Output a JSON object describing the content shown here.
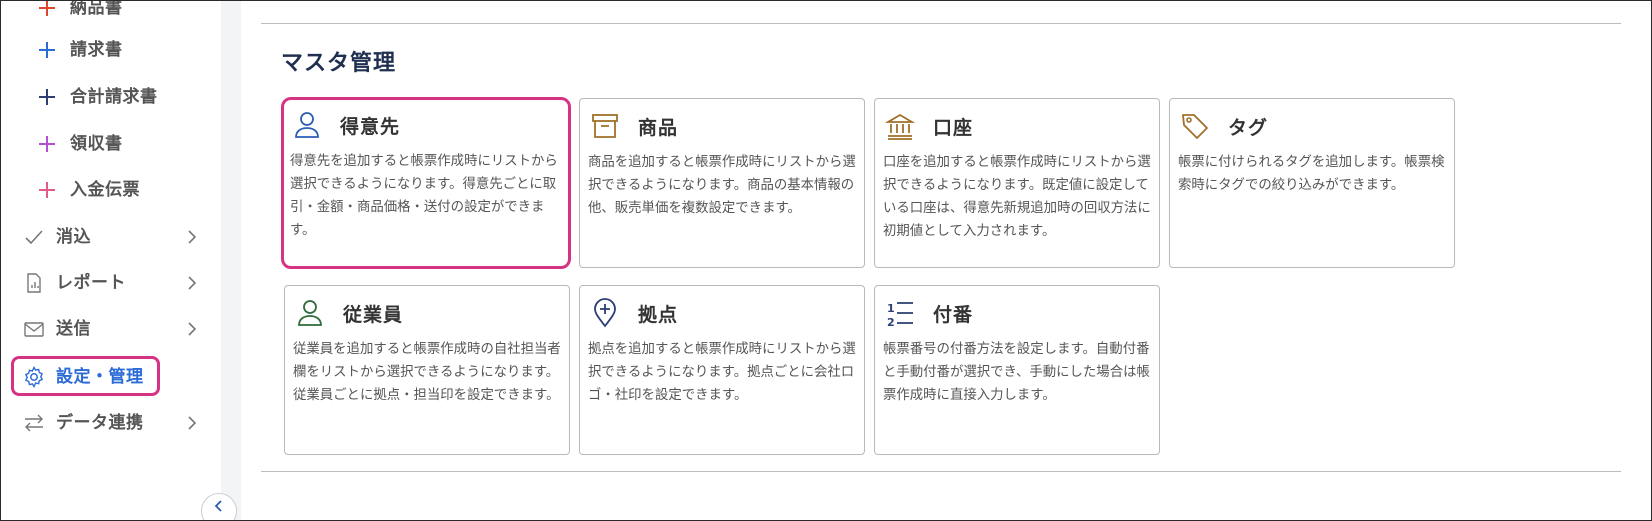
{
  "sidebar": {
    "items": [
      {
        "label": "納品書"
      },
      {
        "label": "請求書"
      },
      {
        "label": "合計請求書"
      },
      {
        "label": "領収書"
      },
      {
        "label": "入金伝票"
      },
      {
        "label": "消込"
      },
      {
        "label": "レポート"
      },
      {
        "label": "送信"
      },
      {
        "label": "設定・管理"
      },
      {
        "label": "データ連携"
      }
    ]
  },
  "main": {
    "section_title": "マスタ管理",
    "cards": [
      {
        "title": "得意先",
        "desc": "得意先を追加すると帳票作成時にリストから選択できるようになります。得意先ごとに取引・金額・商品価格・送付の設定ができます。"
      },
      {
        "title": "商品",
        "desc": "商品を追加すると帳票作成時にリストから選択できるようになります。商品の基本情報の他、販売単価を複数設定できます。"
      },
      {
        "title": "口座",
        "desc": "口座を追加すると帳票作成時にリストから選択できるようになります。既定値に設定している口座は、得意先新規追加時の回収方法に初期値として入力されます。"
      },
      {
        "title": "タグ",
        "desc": "帳票に付けられるタグを追加します。帳票検索時にタグでの絞り込みができます。"
      },
      {
        "title": "従業員",
        "desc": "従業員を追加すると帳票作成時の自社担当者欄をリストから選択できるようになります。従業員ごとに拠点・担当印を設定できます。"
      },
      {
        "title": "拠点",
        "desc": "拠点を追加すると帳票作成時にリストから選択できるようになります。拠点ごとに会社ロゴ・社印を設定できます。"
      },
      {
        "title": "付番",
        "desc": "帳票番号の付番方法を設定します。自動付番と手動付番が選択でき、手動にした場合は帳票作成時に直接入力します。"
      }
    ]
  },
  "colors": {
    "highlight": "#d63384",
    "active_text": "#2b6bd6",
    "plus_blue": "#2b6bd6",
    "plus_navy": "#2c3e73",
    "plus_purple": "#b14fd6",
    "plus_pink": "#e05a8a",
    "plus_red": "#e0452f",
    "icon_blue": "#2b5fb5",
    "icon_brown": "#a0702a",
    "icon_green": "#2f6b3a",
    "icon_navy": "#2c3e73"
  },
  "icons": {
    "sidebar": [
      "plus-icon",
      "plus-icon",
      "plus-icon",
      "plus-icon",
      "plus-icon",
      "check-icon",
      "report-icon",
      "mail-icon",
      "gear-icon",
      "sync-icon"
    ],
    "cards": [
      "person-icon",
      "box-icon",
      "bank-icon",
      "tag-icon",
      "person-icon",
      "map-pin-icon",
      "numbered-list-icon"
    ]
  }
}
